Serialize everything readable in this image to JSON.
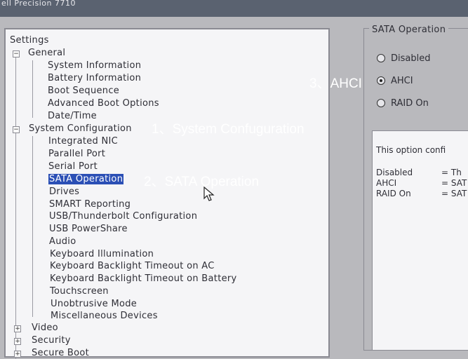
{
  "window": {
    "title": "ell Precision 7710"
  },
  "tree": {
    "root": "Settings",
    "general": {
      "label": "General",
      "items": [
        "System Information",
        "Battery Information",
        "Boot Sequence",
        "Advanced Boot Options",
        "Date/Time"
      ]
    },
    "system_configuration": {
      "label": "System Configuration",
      "items": [
        "Integrated NIC",
        "Parallel Port",
        "Serial Port",
        "SATA Operation",
        "Drives",
        "SMART Reporting",
        "USB/Thunderbolt Configuration",
        "USB PowerShare",
        "Audio",
        "Keyboard Illumination",
        "Keyboard Backlight Timeout on AC",
        "Keyboard Backlight Timeout on Battery",
        "Touchscreen",
        "Unobtrusive Mode",
        "Miscellaneous Devices"
      ],
      "selected": "SATA Operation"
    },
    "collapsed": [
      "Video",
      "Security",
      "Secure Boot"
    ]
  },
  "sata_operation": {
    "title": "SATA Operation",
    "options": [
      {
        "label": "Disabled",
        "checked": false
      },
      {
        "label": "AHCI",
        "checked": true
      },
      {
        "label": "RAID On",
        "checked": false
      }
    ]
  },
  "help": {
    "intro": "This option confi",
    "rows": [
      {
        "name": "Disabled",
        "value": "= Th"
      },
      {
        "name": "AHCI",
        "value": "= SAT"
      },
      {
        "name": "RAID On",
        "value": "= SAT"
      }
    ]
  },
  "annotations": {
    "step1": "1、System Confuguration",
    "step2": "2、SATA Operation",
    "step3": "3、AHCI"
  }
}
